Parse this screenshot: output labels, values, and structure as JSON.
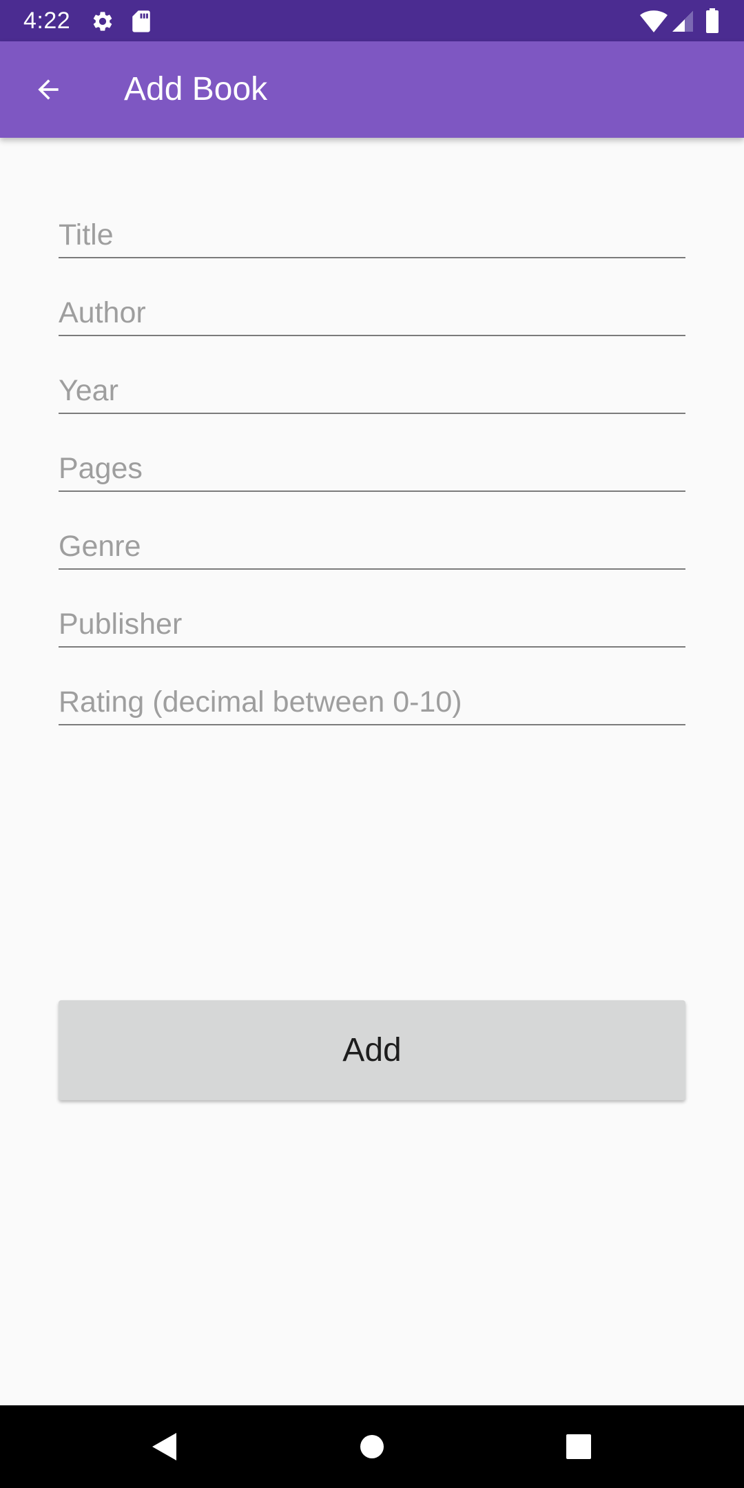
{
  "status_bar": {
    "time": "4:22",
    "left_icons": [
      "gear-icon",
      "sd-card-icon"
    ],
    "right_icons": [
      "wifi-icon",
      "cell-signal-icon",
      "battery-icon"
    ]
  },
  "app_bar": {
    "back_icon": "arrow-back-icon",
    "title": "Add Book"
  },
  "form": {
    "title_placeholder": "Title",
    "author_placeholder": "Author",
    "year_placeholder": "Year",
    "pages_placeholder": "Pages",
    "genre_placeholder": "Genre",
    "publisher_placeholder": "Publisher",
    "rating_placeholder": "Rating (decimal between 0-10)"
  },
  "actions": {
    "add_label": "Add"
  },
  "nav_bar": {
    "icons": [
      "nav-back-icon",
      "nav-home-icon",
      "nav-recents-icon"
    ]
  },
  "colors": {
    "status_bar": "#4b2c91",
    "app_bar": "#7e57c2",
    "background": "#fafafa",
    "button": "#d6d7d7",
    "placeholder": "#9e9e9e",
    "underline": "#7b7b7b"
  }
}
